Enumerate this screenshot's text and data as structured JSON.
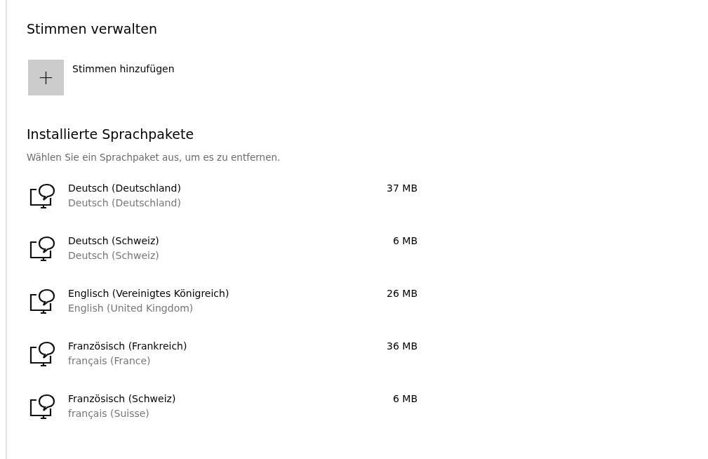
{
  "manage_voices": {
    "title": "Stimmen verwalten",
    "add_button": {
      "icon": "+",
      "label": "Stimmen hinzufügen"
    }
  },
  "installed": {
    "title": "Installierte Sprachpakete",
    "description": "Wählen Sie ein Sprachpaket aus, um es zu entfernen.",
    "packages": [
      {
        "name": "Deutsch (Deutschland)",
        "native_name": "Deutsch (Deutschland)",
        "size": "37 MB"
      },
      {
        "name": "Deutsch (Schweiz)",
        "native_name": "Deutsch (Schweiz)",
        "size": "6 MB"
      },
      {
        "name": "Englisch (Vereinigtes Königreich)",
        "native_name": "English (United Kingdom)",
        "size": "26 MB"
      },
      {
        "name": "Französisch (Frankreich)",
        "native_name": "français (France)",
        "size": "36 MB"
      },
      {
        "name": "Französisch (Schweiz)",
        "native_name": "français (Suisse)",
        "size": "6 MB"
      }
    ]
  }
}
